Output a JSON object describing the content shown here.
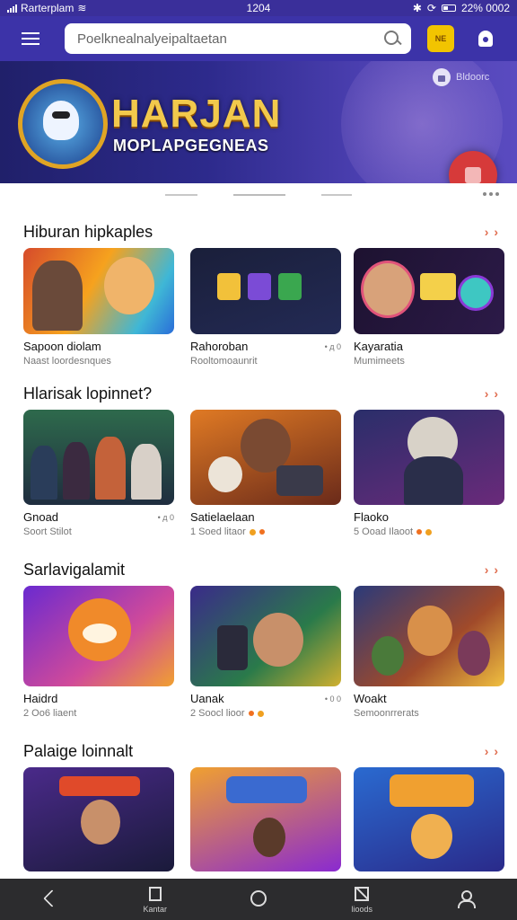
{
  "status_bar": {
    "carrier": "Rarterplam",
    "time": "1204",
    "battery": "22% 0002"
  },
  "header": {
    "search_placeholder": "Poelknealnalyeipaltaetan",
    "badge_label": "NE",
    "icons": [
      "menu-icon",
      "search-icon",
      "badge-icon",
      "bell-icon"
    ]
  },
  "banner": {
    "title": "HARJAN",
    "subtitle": "MOPLAPGEGNEAS",
    "chip_label": "Bldoorc",
    "colors": {
      "title": "#f2c94c",
      "fab": "#d63a3a",
      "bg": "#2d2a8c"
    }
  },
  "sections": [
    {
      "title": "Hiburan hipkaples",
      "cards": [
        {
          "title": "Sapoon diolam",
          "meta": "",
          "sub": "Naast loordesnques"
        },
        {
          "title": "Rahoroban",
          "meta": "• д 0",
          "sub": "Rooltomoaunrit"
        },
        {
          "title": "Kayaratia",
          "meta": "",
          "sub": "Mumimeets"
        }
      ]
    },
    {
      "title": "Hlarisak lopinnet?",
      "cards": [
        {
          "title": "Gnoad",
          "meta": "• д 0",
          "sub": "Soort Stilot"
        },
        {
          "title": "Satielaelaan",
          "meta": "",
          "sub": "1 Soed litaor"
        },
        {
          "title": "Flaoko",
          "meta": "",
          "sub": "5 Ooad Ilaoot"
        }
      ]
    },
    {
      "title": "Sarlavigalamit",
      "cards": [
        {
          "title": "Haidrd",
          "meta": "",
          "sub": "2 Oo6 liaent"
        },
        {
          "title": "Uanak",
          "meta": "• 0 0",
          "sub": "2 Soocl lioor"
        },
        {
          "title": "Woakt",
          "meta": "",
          "sub": "Semoonrrerats"
        }
      ]
    },
    {
      "title": "Palaige loinnalt",
      "cards": [
        {
          "title": "",
          "meta": "",
          "sub": ""
        },
        {
          "title": "",
          "meta": "",
          "sub": ""
        },
        {
          "title": "",
          "meta": "",
          "sub": ""
        }
      ]
    }
  ],
  "bottom_nav": [
    {
      "icon": "back-icon",
      "label": ""
    },
    {
      "icon": "square-icon",
      "label": "Kantar"
    },
    {
      "icon": "home-circle-icon",
      "label": ""
    },
    {
      "icon": "box-icon",
      "label": "lioods"
    },
    {
      "icon": "profile-icon",
      "label": ""
    }
  ]
}
